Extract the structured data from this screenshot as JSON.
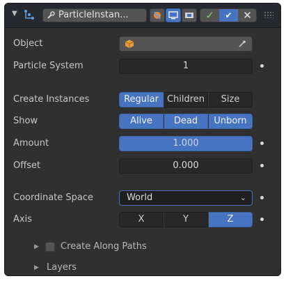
{
  "header": {
    "node_name": "ParticleInstan...",
    "icons": [
      "collapse-arrow",
      "particle-instance-icon",
      "wrench-icon",
      "eyedropper-icon",
      "monitor-icon",
      "camera-icon",
      "check-icon",
      "tick-icon",
      "close-icon",
      "drag-grip"
    ]
  },
  "object": {
    "label": "Object",
    "value": ""
  },
  "particle_system": {
    "label": "Particle System",
    "value": "1"
  },
  "create_instances": {
    "label": "Create Instances",
    "options": [
      "Regular",
      "Children",
      "Size"
    ],
    "selected": [
      "Regular"
    ]
  },
  "show": {
    "label": "Show",
    "options": [
      "Alive",
      "Dead",
      "Unborn"
    ],
    "selected": [
      "Alive",
      "Dead",
      "Unborn"
    ]
  },
  "amount": {
    "label": "Amount",
    "value": "1.000"
  },
  "offset": {
    "label": "Offset",
    "value": "0.000"
  },
  "coordinate_space": {
    "label": "Coordinate Space",
    "value": "World"
  },
  "axis": {
    "label": "Axis",
    "options": [
      "X",
      "Y",
      "Z"
    ],
    "selected": [
      "Z"
    ]
  },
  "create_along_paths": {
    "label": "Create Along Paths",
    "checked": false
  },
  "layers": {
    "label": "Layers"
  },
  "colors": {
    "accent": "#4674c0",
    "panel": "#303030",
    "header": "#26292e",
    "field": "#282828",
    "check": "#7fd15f"
  }
}
